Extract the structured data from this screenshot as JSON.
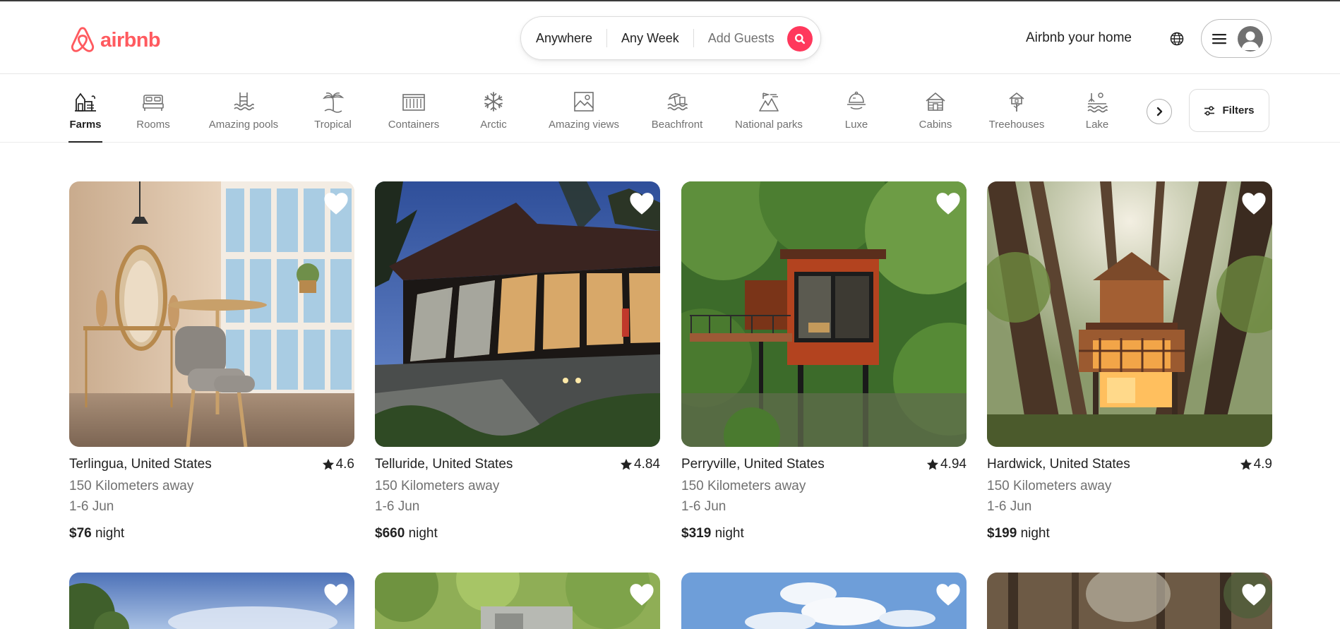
{
  "brand": {
    "name": "airbnb",
    "color": "#ff5a5f"
  },
  "search": {
    "where": "Anywhere",
    "when": "Any Week",
    "who": "Add Guests",
    "accent": "#ff385c",
    "icon": "search-icon"
  },
  "header": {
    "host_link": "Airbnb your home",
    "globe_icon": "globe-icon",
    "menu_icon": "hamburger-icon",
    "avatar_icon": "user-icon"
  },
  "categories": [
    {
      "label": "Farms",
      "icon": "barn-icon",
      "active": true
    },
    {
      "label": "Rooms",
      "icon": "bed-icon"
    },
    {
      "label": "Amazing pools",
      "icon": "pool-icon"
    },
    {
      "label": "Tropical",
      "icon": "palm-icon"
    },
    {
      "label": "Containers",
      "icon": "container-icon"
    },
    {
      "label": "Arctic",
      "icon": "snowflake-icon"
    },
    {
      "label": "Amazing views",
      "icon": "view-icon"
    },
    {
      "label": "Beachfront",
      "icon": "beach-icon"
    },
    {
      "label": "National parks",
      "icon": "park-icon"
    },
    {
      "label": "Luxe",
      "icon": "luxe-icon"
    },
    {
      "label": "Cabins",
      "icon": "cabin-icon"
    },
    {
      "label": "Treehouses",
      "icon": "treehouse-icon"
    },
    {
      "label": "Lake",
      "icon": "lake-icon"
    }
  ],
  "filters": {
    "label": "Filters",
    "icon": "sliders-icon"
  },
  "listings": [
    {
      "location": "Terlingua, United States",
      "rating": "4.6",
      "distance": "150 Kilometers away",
      "dates": "1-6 Jun",
      "price": "$76",
      "price_unit": "night"
    },
    {
      "location": "Telluride, United States",
      "rating": "4.84",
      "distance": "150 Kilometers away",
      "dates": "1-6 Jun",
      "price": "$660",
      "price_unit": "night"
    },
    {
      "location": "Perryville, United States",
      "rating": "4.94",
      "distance": "150 Kilometers away",
      "dates": "1-6 Jun",
      "price": "$319",
      "price_unit": "night"
    },
    {
      "location": "Hardwick, United States",
      "rating": "4.9",
      "distance": "150 Kilometers away",
      "dates": "1-6 Jun",
      "price": "$199",
      "price_unit": "night"
    }
  ]
}
